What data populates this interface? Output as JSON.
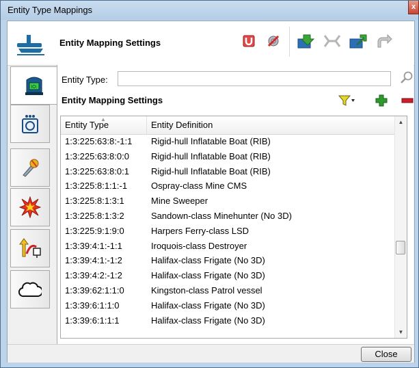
{
  "window": {
    "title": "Entity Type Mappings",
    "close_glyph": "x"
  },
  "header": {
    "title": "Entity Mapping Settings",
    "toolbar": [
      "magnet-icon",
      "gear-icon",
      "import-icon",
      "merge-icon",
      "export-icon",
      "redo-icon"
    ]
  },
  "sidebar": {
    "tabs": [
      {
        "name": "vehicle-tab",
        "icon": "vehicle-icon",
        "active": true
      },
      {
        "name": "sensor-tab",
        "icon": "sensor-icon",
        "active": false
      },
      {
        "name": "weapon-tab",
        "icon": "microphone-icon",
        "active": false
      },
      {
        "name": "explosion-tab",
        "icon": "explosion-icon",
        "active": false
      },
      {
        "name": "route-tab",
        "icon": "route-icon",
        "active": false
      },
      {
        "name": "cloud-tab",
        "icon": "cloud-icon",
        "active": false
      }
    ]
  },
  "form": {
    "entity_type_label": "Entity Type:",
    "entity_type_value": "",
    "section_title": "Entity Mapping Settings"
  },
  "table": {
    "columns": [
      "Entity Type",
      "Entity Definition"
    ],
    "rows": [
      [
        "1:3:225:63:8:-1:1",
        "Rigid-hull Inflatable Boat (RIB)"
      ],
      [
        "1:3:225:63:8:0:0",
        "Rigid-hull Inflatable Boat (RIB)"
      ],
      [
        "1:3:225:63:8:0:1",
        "Rigid-hull Inflatable Boat (RIB)"
      ],
      [
        "1:3:225:8:1:1:-1",
        "Ospray-class Mine CMS"
      ],
      [
        "1:3:225:8:1:3:1",
        "Mine Sweeper"
      ],
      [
        "1:3:225:8:1:3:2",
        "Sandown-class Minehunter (No 3D)"
      ],
      [
        "1:3:225:9:1:9:0",
        "Harpers Ferry-class LSD"
      ],
      [
        "1:3:39:4:1:-1:1",
        "Iroquois-class Destroyer"
      ],
      [
        "1:3:39:4:1:-1:2",
        "Halifax-class Frigate (No 3D)"
      ],
      [
        "1:3:39:4:2:-1:2",
        "Halifax-class Frigate (No 3D)"
      ],
      [
        "1:3:39:62:1:1:0",
        "Kingston-class Patrol vessel"
      ],
      [
        "1:3:39:6:1:1:0",
        "Halifax-class Frigate (No 3D)"
      ],
      [
        "1:3:39:6:1:1:1",
        "Halifax-class Frigate (No 3D)"
      ]
    ]
  },
  "footer": {
    "close_label": "Close"
  },
  "colors": {
    "title_bar": "#bcd3ea",
    "accent_green": "#2e9a2e",
    "accent_red": "#cc1f2a"
  }
}
